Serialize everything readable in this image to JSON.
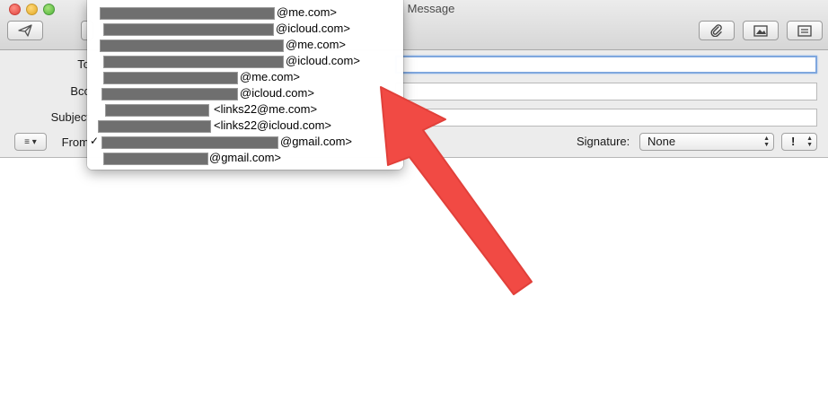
{
  "window": {
    "title": "Message"
  },
  "toolbar": {
    "send_icon": "paper-plane-icon",
    "attach_icon": "paperclip-icon",
    "photo_icon": "photo-browser-icon",
    "format_icon": "format-bar-icon"
  },
  "header": {
    "to_label": "To",
    "bcc_label": "Bcc",
    "subject_label": "Subject",
    "from_label": "From",
    "format_popup_label": "≡ ▾",
    "signature_label": "Signature:",
    "signature_value": "None",
    "priority_value": "!"
  },
  "from_menu": {
    "items": [
      {
        "address": "@me.com>",
        "checked": false
      },
      {
        "address": "@icloud.com>",
        "checked": false
      },
      {
        "address": "@me.com>",
        "checked": false
      },
      {
        "address": "@icloud.com>",
        "checked": false
      },
      {
        "address": "@me.com>",
        "checked": false
      },
      {
        "address": "@icloud.com>",
        "checked": false
      },
      {
        "address": "<links22@me.com>",
        "checked": false
      },
      {
        "address": "<links22@icloud.com>",
        "checked": false
      },
      {
        "address": "@gmail.com>",
        "checked": true
      },
      {
        "address": "@gmail.com>",
        "checked": false
      }
    ],
    "check_mark": "✓"
  },
  "colors": {
    "annotation_arrow": "#f14a44",
    "focus_ring": "#7fa7de"
  }
}
